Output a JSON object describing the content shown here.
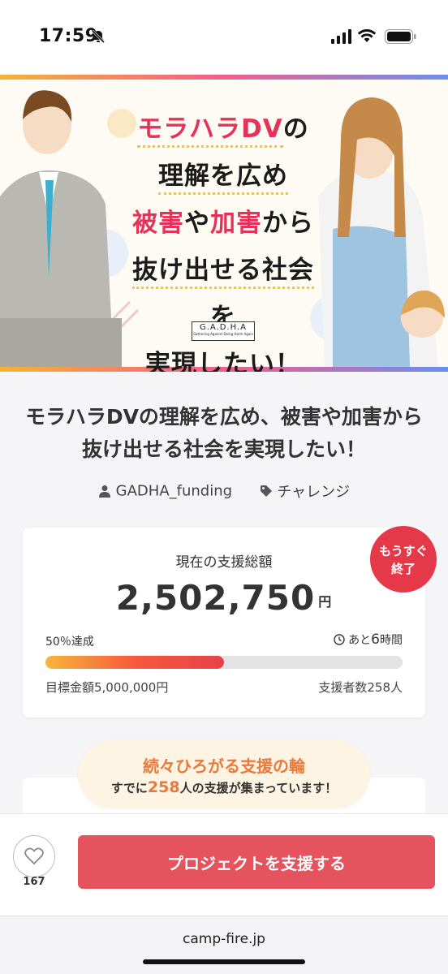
{
  "status_bar": {
    "time": "17:59"
  },
  "hero": {
    "headline_line1_red": "モラハラDV",
    "headline_line1_rest": "の",
    "headline_line2": "理解を広め",
    "headline_line3_red1": "被害",
    "headline_line3_mid": "や",
    "headline_line3_red2": "加害",
    "headline_line3_rest": "から",
    "headline_line4": "抜け出せる社会を",
    "headline_line5": "実現したい！",
    "logo_text": "G.A.D.H.A",
    "logo_sub": "Gathering Against Doing Harm Again"
  },
  "project": {
    "title": "モラハラDVの理解を広め、被害や加害から抜け出せる社会を実現したい！",
    "owner": "GADHA_funding",
    "category": "チャレンジ"
  },
  "funding": {
    "label": "現在の支援総額",
    "amount": "2,502,750",
    "currency": "円",
    "percent_text": "50％達成",
    "progress_percent": 50,
    "remaining_prefix": "あと",
    "remaining_value": "6",
    "remaining_suffix": "時間",
    "goal": "目標金額5,000,000円",
    "backers": "支援者数258人",
    "badge_line1": "もうすぐ",
    "badge_line2": "終了"
  },
  "support_ring": {
    "heading": "続々ひろがる支援の輪",
    "text_before": "すでに",
    "count": "258",
    "text_after": "人の支援が集まっています！"
  },
  "action_bar": {
    "like_count": "167",
    "support_button": "プロジェクトを支援する"
  },
  "browser": {
    "url": "camp-fire.jp"
  },
  "colors": {
    "accent": "#e5535f",
    "badge": "#e5394a",
    "progress_start": "#f8b53c",
    "progress_end": "#e8414a"
  }
}
